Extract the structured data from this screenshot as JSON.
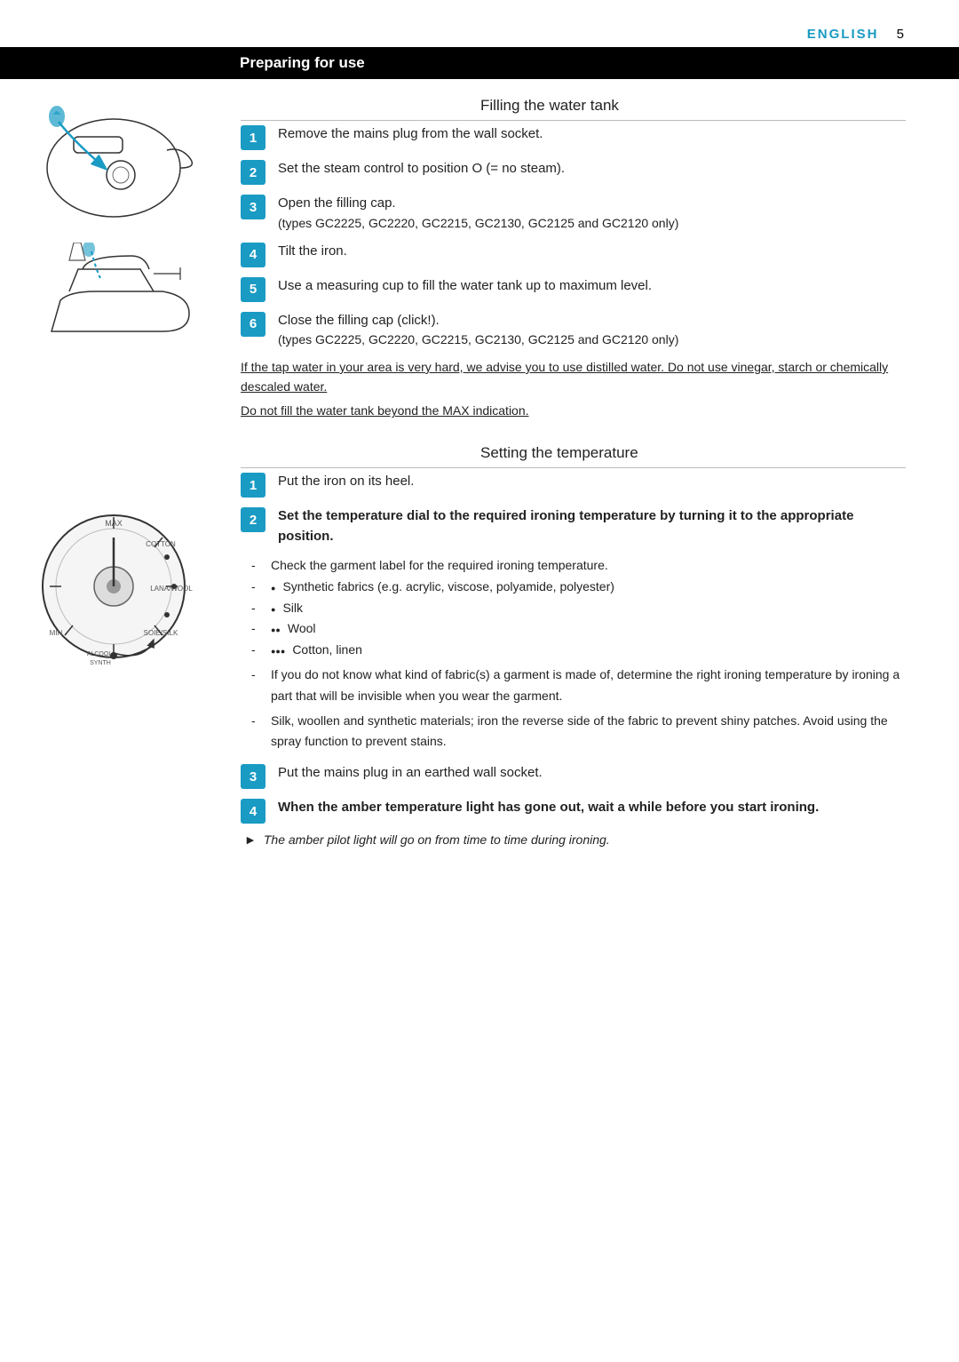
{
  "header": {
    "language": "ENGLISH",
    "page_number": "5"
  },
  "section": {
    "title": "Preparing for use"
  },
  "filling_subsection": {
    "title": "Filling the water tank",
    "steps": [
      {
        "num": "1",
        "text": "Remove the mains plug from the wall socket."
      },
      {
        "num": "2",
        "text": "Set the steam control to position O (= no steam)."
      },
      {
        "num": "3",
        "text": "Open the filling cap.",
        "note": "(types GC2225, GC2220, GC2215, GC2130, GC2125 and GC2120 only)"
      },
      {
        "num": "4",
        "text": "Tilt the iron."
      },
      {
        "num": "5",
        "text": "Use a measuring cup to fill the water tank up to maximum level."
      },
      {
        "num": "6",
        "text": "Close the filling cap (click!).",
        "note": "(types GC2225, GC2220, GC2215, GC2130, GC2125 and GC2120 only)"
      }
    ],
    "advisory1": "If the tap water in your area is very hard, we advise you to use distilled water. Do not use vinegar, starch or chemically descaled water.",
    "advisory2": "Do not fill the water tank beyond the MAX indication."
  },
  "temperature_subsection": {
    "title": "Setting the temperature",
    "steps": [
      {
        "num": "1",
        "text": "Put the iron on its heel."
      },
      {
        "num": "2",
        "text": "Set the temperature dial to the required ironing temperature by turning it to the appropriate position.",
        "bold": true
      }
    ],
    "bullet_items": [
      {
        "prefix": "-",
        "dots": 0,
        "text": "Check the garment label for the required ironing temperature."
      },
      {
        "prefix": "-",
        "dots": 1,
        "text": "Synthetic fabrics (e.g. acrylic, viscose, polyamide, polyester)"
      },
      {
        "prefix": "-",
        "dots": 1,
        "text": "Silk"
      },
      {
        "prefix": "-",
        "dots": 2,
        "text": "Wool"
      },
      {
        "prefix": "-",
        "dots": 3,
        "text": "Cotton, linen"
      },
      {
        "prefix": "-",
        "dots": 0,
        "text": "If you do not know what kind of fabric(s) a garment is made of, determine the right ironing temperature by ironing a part that will be invisible when you wear the garment."
      },
      {
        "prefix": "-",
        "dots": 0,
        "text": "Silk, woollen and synthetic materials; iron the reverse side of the fabric to prevent shiny patches. Avoid using the spray function to prevent stains."
      }
    ],
    "steps2": [
      {
        "num": "3",
        "text": "Put the mains plug in an earthed wall socket."
      },
      {
        "num": "4",
        "text": "When the amber temperature light has gone out, wait a while before you start ironing.",
        "bold": true
      }
    ],
    "italic_note": "The amber pilot light will go on from time to time during ironing."
  }
}
